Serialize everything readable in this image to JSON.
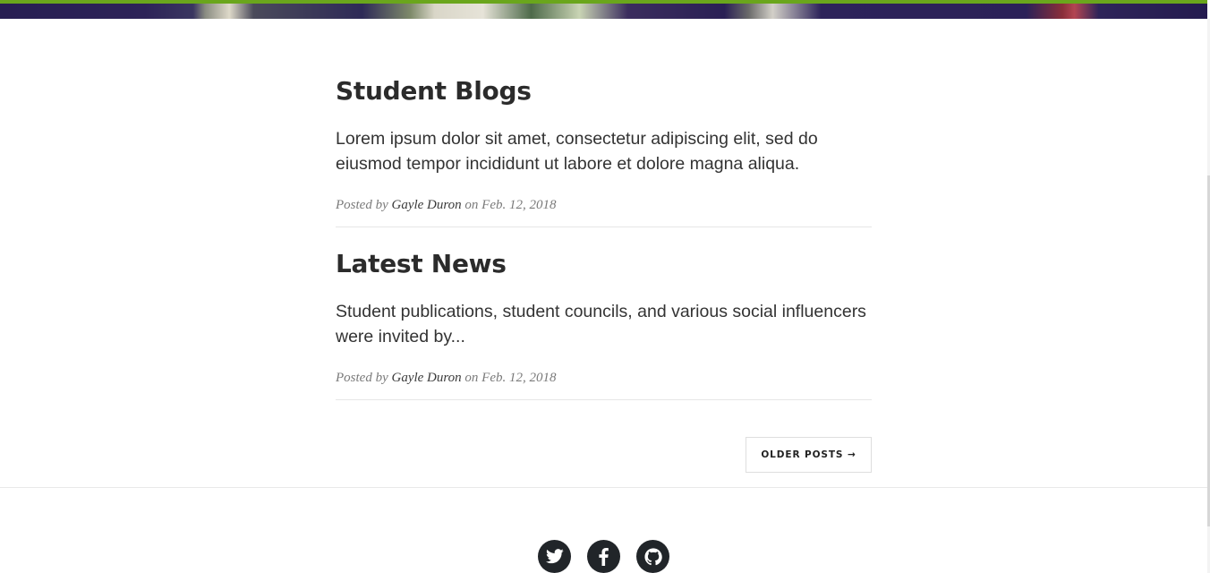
{
  "posts": [
    {
      "title": "Student Blogs",
      "excerpt": "Lorem ipsum dolor sit amet, consectetur adipiscing elit, sed do eiusmod tempor incididunt ut labore et dolore magna aliqua.",
      "meta_prefix": "Posted by",
      "author": "Gayle Duron",
      "meta_on": "on",
      "date": "Feb. 12, 2018"
    },
    {
      "title": "Latest News",
      "excerpt": "Student publications, student councils, and various social influencers were invited by...",
      "meta_prefix": "Posted by",
      "author": "Gayle Duron",
      "meta_on": "on",
      "date": "Feb. 12, 2018"
    }
  ],
  "pager": {
    "older_label": "OLDER POSTS →"
  },
  "footer": {
    "social_icons": [
      "twitter-icon",
      "facebook-icon",
      "github-icon"
    ]
  },
  "colors": {
    "accent": "#6aa61c",
    "text_dark": "#2b2b2b",
    "social_bg": "#212529"
  }
}
